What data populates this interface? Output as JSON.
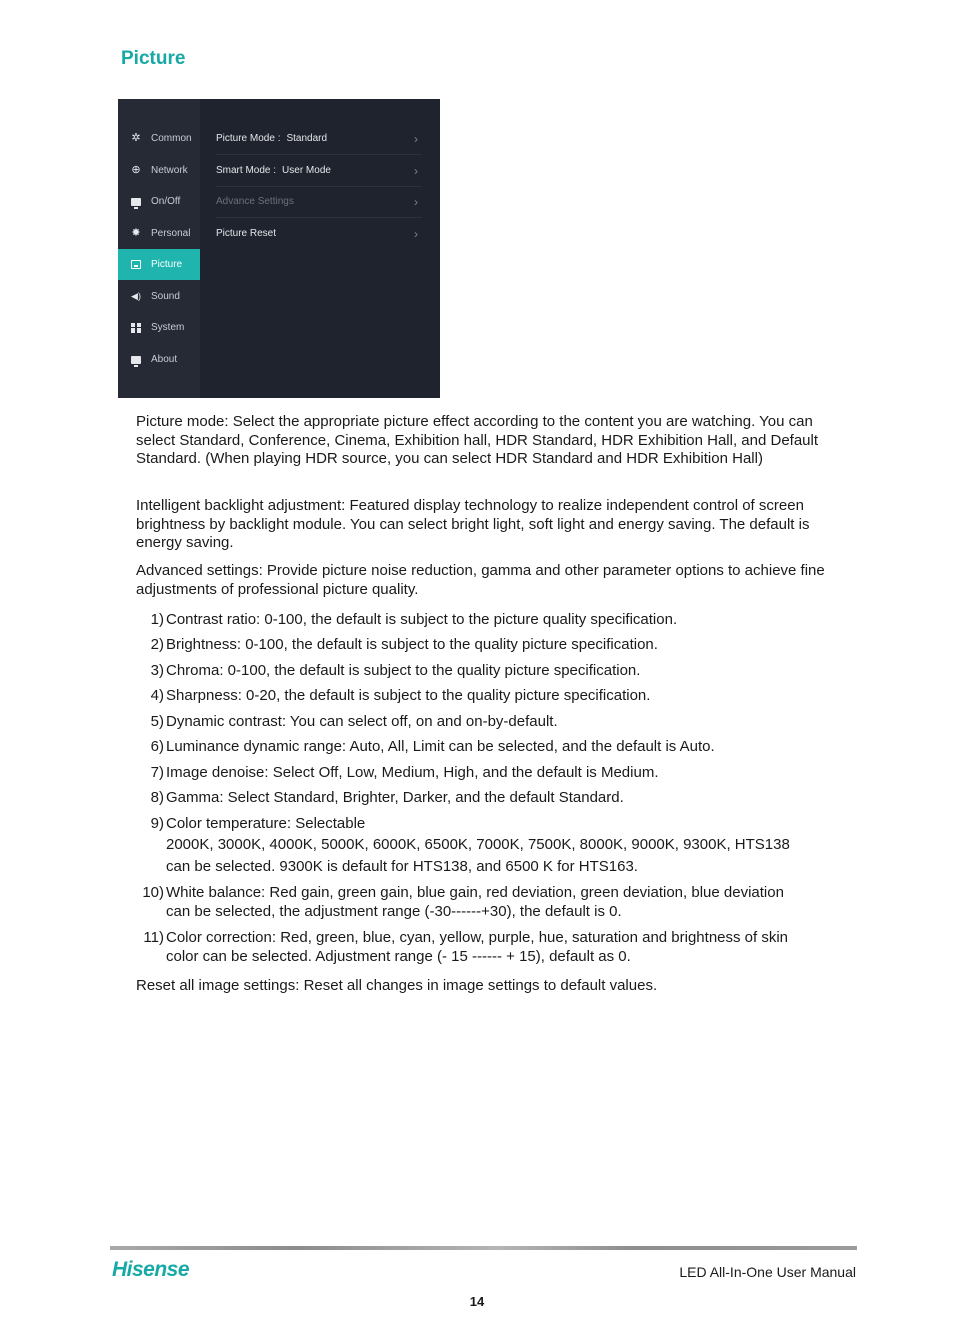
{
  "section": {
    "title": "Picture"
  },
  "menu": {
    "sidebar": [
      {
        "label": "Common",
        "icon": "gear-icon",
        "glyph": "✲",
        "active": false
      },
      {
        "label": "Network",
        "icon": "globe-icon",
        "glyph": "⊕",
        "active": false
      },
      {
        "label": "On/Off",
        "icon": "power-monitor-icon",
        "glyph": "",
        "active": false
      },
      {
        "label": "Personal",
        "icon": "star-burst-icon",
        "glyph": "✸",
        "active": false
      },
      {
        "label": "Picture",
        "icon": "image-icon",
        "glyph": "",
        "active": true
      },
      {
        "label": "Sound",
        "icon": "speaker-icon",
        "glyph": "◀)",
        "active": false
      },
      {
        "label": "System",
        "icon": "grid-icon",
        "glyph": "",
        "active": false
      },
      {
        "label": "About",
        "icon": "info-monitor-icon",
        "glyph": "",
        "active": false
      }
    ],
    "rows": [
      {
        "label": "Picture Mode :",
        "value": "Standard",
        "disabled": false,
        "chevron": "›"
      },
      {
        "label": "Smart Mode :",
        "value": "User Mode",
        "disabled": false,
        "chevron": "›"
      },
      {
        "label": "Advance Settings",
        "value": "",
        "disabled": true,
        "chevron": "›"
      },
      {
        "label": "Picture Reset",
        "value": "",
        "disabled": false,
        "chevron": "›"
      }
    ],
    "accent_color": "#1fb5ae"
  },
  "paragraphs": {
    "picture_mode": "Picture mode: Select the appropriate picture effect according to the content you are watching. You can select Standard, Conference, Cinema, Exhibition hall, HDR Standard, HDR Exhibition Hall, and Default Standard. (When playing HDR source, you can select HDR Standard and HDR Exhibition Hall)",
    "backlight": "Intelligent backlight adjustment: Featured display technology to realize independent control of screen brightness by backlight module. You can select bright light, soft light and energy saving. The default is energy saving.",
    "advanced": "Advanced settings: Provide picture noise reduction, gamma and other parameter options to achieve fine adjustments of professional picture quality.",
    "reset": "Reset all image settings: Reset all changes in image settings to default values."
  },
  "advanced_list": [
    {
      "num": "1)",
      "text": "Contrast ratio: 0-100, the default is subject to the picture quality specification."
    },
    {
      "num": "2)",
      "text": "Brightness: 0-100, the default is subject to the quality picture specification."
    },
    {
      "num": "3)",
      "text": "Chroma: 0-100, the default is subject to the quality picture specification."
    },
    {
      "num": "4)",
      "text": "Sharpness: 0-20, the default is subject to the quality picture specification."
    },
    {
      "num": "5)",
      "text": "Dynamic contrast: You can select off, on and on-by-default."
    },
    {
      "num": "6)",
      "text": "Luminance dynamic range: Auto, All, Limit can be selected, and the default is Auto."
    },
    {
      "num": "7)",
      "text": "Image denoise: Select Off, Low, Medium, High, and the default is Medium."
    },
    {
      "num": "8)",
      "text": "Gamma: Select Standard, Brighter, Darker, and the default Standard."
    },
    {
      "num": "9)",
      "text": "Color temperature: Selectable",
      "line2": "2000K, 3000K, 4000K, 5000K, 6000K, 6500K, 7000K, 7500K, 8000K, 9000K, 9300K, HTS138",
      "line3": "can be selected. 9300K is default for HTS138, and 6500 K for HTS163."
    },
    {
      "num": "10)",
      "text": "White balance: Red gain, green gain, blue gain, red deviation, green deviation, blue deviation",
      "line2": "can be selected, the adjustment range (-30------+30), the default is 0."
    },
    {
      "num": "11)",
      "text": "Color correction: Red, green, blue, cyan, yellow, purple, hue, saturation and brightness of skin",
      "line2": "color can be selected. Adjustment range (- 15 ------ + 15), default as 0."
    }
  ],
  "footer": {
    "brand": "Hisense",
    "manual_title": "LED All-In-One User Manual",
    "page_number": "14",
    "brand_color": "#16a9a6"
  }
}
